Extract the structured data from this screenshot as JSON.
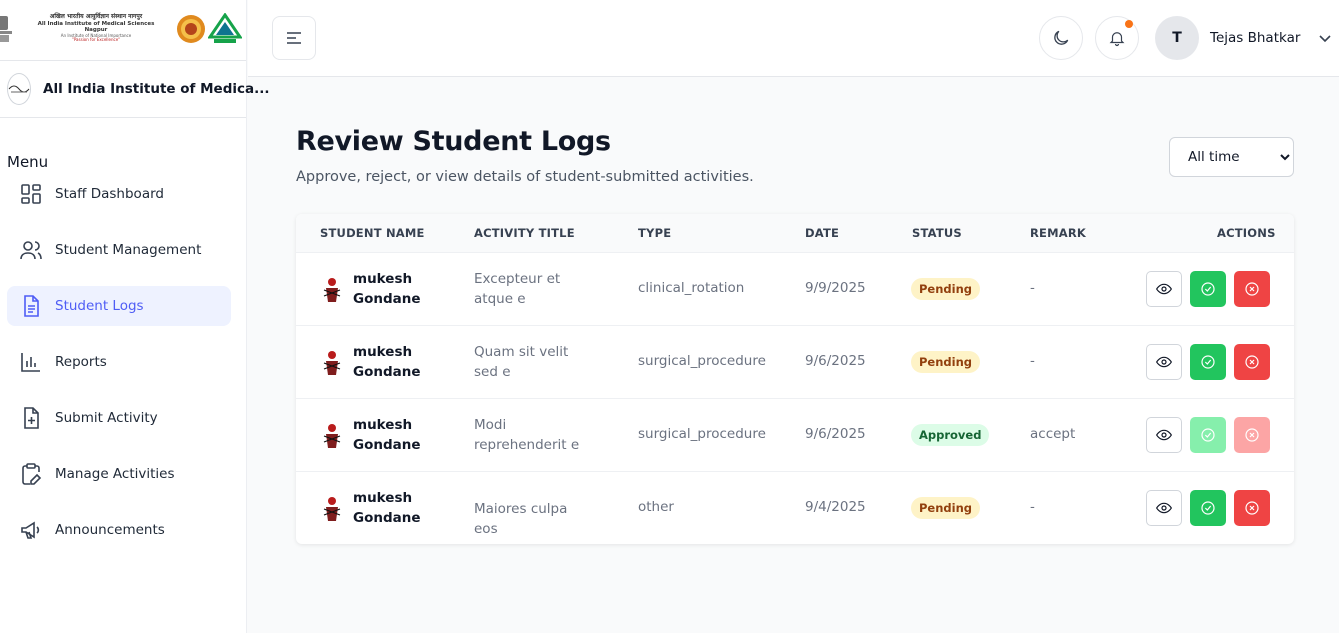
{
  "sidebar": {
    "logo_text": {
      "line1": "अखिल भारतीय आयुर्विज्ञान संस्थान नागपुर",
      "line2": "All India Institute of Medical Sciences Nagpur",
      "line3": "An Institute of National Importance",
      "line4": "\"Passion for Excellence\""
    },
    "institution_name": "All India Institute of Medica...",
    "menu_label": "Menu",
    "items": [
      {
        "label": "Staff Dashboard",
        "icon": "dashboard-icon",
        "active": false
      },
      {
        "label": "Student Management",
        "icon": "users-icon",
        "active": false
      },
      {
        "label": "Student Logs",
        "icon": "document-icon",
        "active": true
      },
      {
        "label": "Reports",
        "icon": "bar-chart-icon",
        "active": false
      },
      {
        "label": "Submit Activity",
        "icon": "file-plus-icon",
        "active": false
      },
      {
        "label": "Manage Activities",
        "icon": "clipboard-edit-icon",
        "active": false
      },
      {
        "label": "Announcements",
        "icon": "megaphone-icon",
        "active": false
      }
    ]
  },
  "header": {
    "avatar_initial": "T",
    "user_name": "Tejas Bhatkar"
  },
  "main": {
    "title": "Review Student Logs",
    "subtitle": "Approve, reject, or view details of student-submitted activities.",
    "filter": {
      "selected": "All time"
    },
    "columns": [
      "STUDENT NAME",
      "ACTIVITY TITLE",
      "TYPE",
      "DATE",
      "STATUS",
      "REMARK",
      "ACTIONS"
    ],
    "rows": [
      {
        "student": "mukesh Gondane",
        "title": "Excepteur et atque e",
        "type": "clinical_rotation",
        "date": "9/9/2025",
        "status": "Pending",
        "remark": "-",
        "actions_enabled": true
      },
      {
        "student": "mukesh Gondane",
        "title": "Quam sit velit sed e",
        "type": "surgical_procedure",
        "date": "9/6/2025",
        "status": "Pending",
        "remark": "-",
        "actions_enabled": true
      },
      {
        "student": "mukesh Gondane",
        "title": "Modi reprehenderit e",
        "type": "surgical_procedure",
        "date": "9/6/2025",
        "status": "Approved",
        "remark": "accept",
        "actions_enabled": false
      },
      {
        "student": "mukesh Gondane",
        "title": "Maiores culpa eos",
        "type": "other",
        "date": "9/4/2025",
        "status": "Pending",
        "remark": "-",
        "actions_enabled": true
      }
    ]
  },
  "colors": {
    "accent": "#4f5df5",
    "approve": "#22c55e",
    "reject": "#ef4444",
    "notification": "#f97316"
  }
}
